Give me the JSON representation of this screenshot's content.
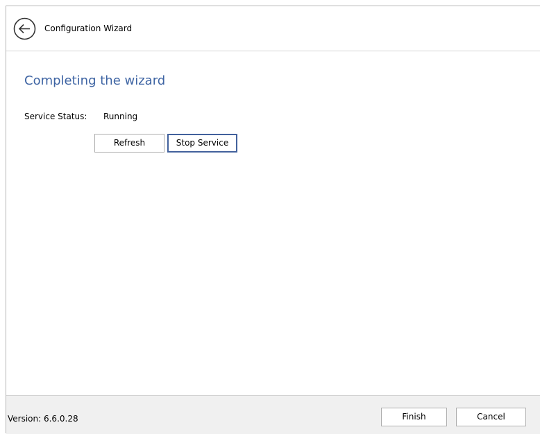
{
  "header": {
    "title": "Configuration Wizard",
    "back_icon": "arrow-left-circle-icon"
  },
  "main": {
    "title": "Completing the wizard",
    "status_label": "Service Status:",
    "status_value": "Running",
    "refresh_label": "Refresh",
    "stop_label": "Stop Service"
  },
  "footer": {
    "version": "Version: 6.6.0.28",
    "finish_label": "Finish",
    "cancel_label": "Cancel"
  },
  "colors": {
    "title_accent": "#3e64a3",
    "focused_button_border": "#42619c",
    "footer_background": "#f0f0f0"
  }
}
